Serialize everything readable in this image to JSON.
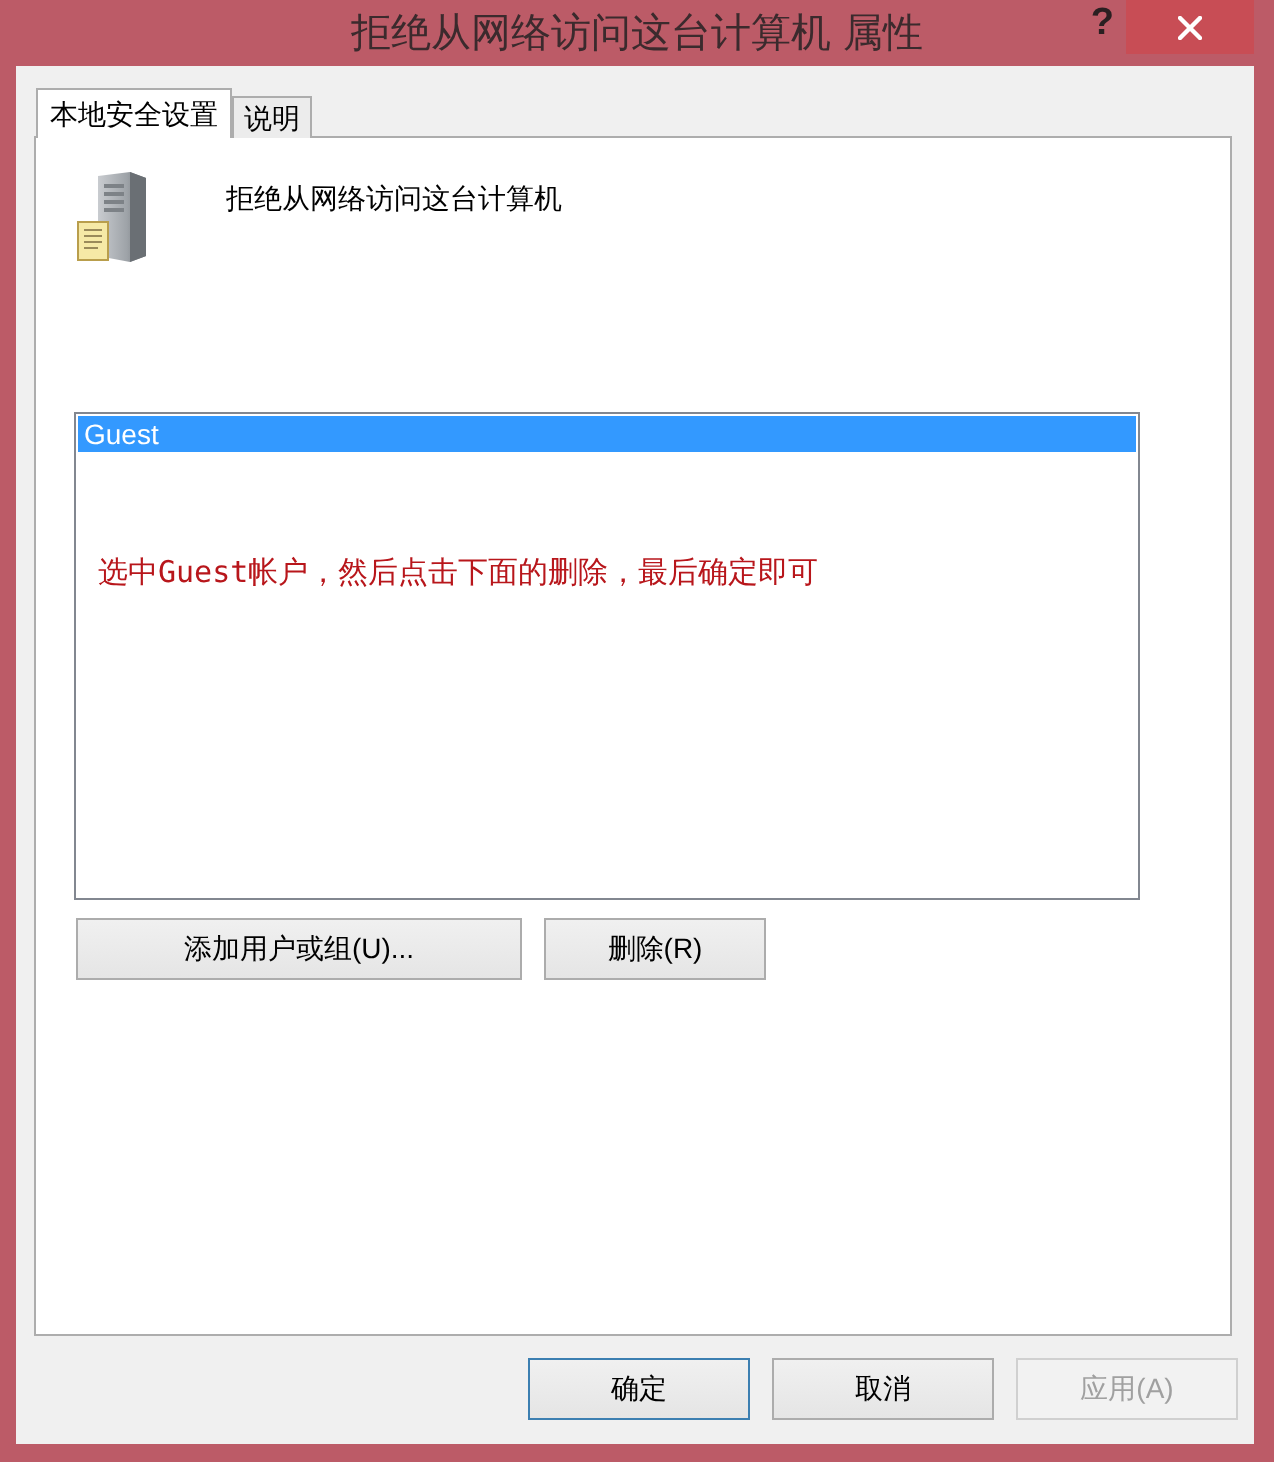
{
  "window": {
    "title": "拒绝从网络访问这台计算机 属性",
    "help_button": "?"
  },
  "tabs": [
    {
      "label": "本地安全设置",
      "selected": true
    },
    {
      "label": "说明",
      "selected": false
    }
  ],
  "policy": {
    "title": "拒绝从网络访问这台计算机"
  },
  "accounts": {
    "items": [
      {
        "label": "Guest",
        "selected": true
      }
    ],
    "annotation": "选中Guest帐户，然后点击下面的删除，最后确定即可"
  },
  "list_buttons": [
    {
      "label": "添加用户或组(U)..."
    },
    {
      "label": "删除(R)"
    }
  ],
  "dialog_buttons": [
    {
      "label": "确定",
      "focused": true,
      "disabled": false
    },
    {
      "label": "取消",
      "focused": false,
      "disabled": false
    },
    {
      "label": "应用(A)",
      "focused": false,
      "disabled": true
    }
  ]
}
